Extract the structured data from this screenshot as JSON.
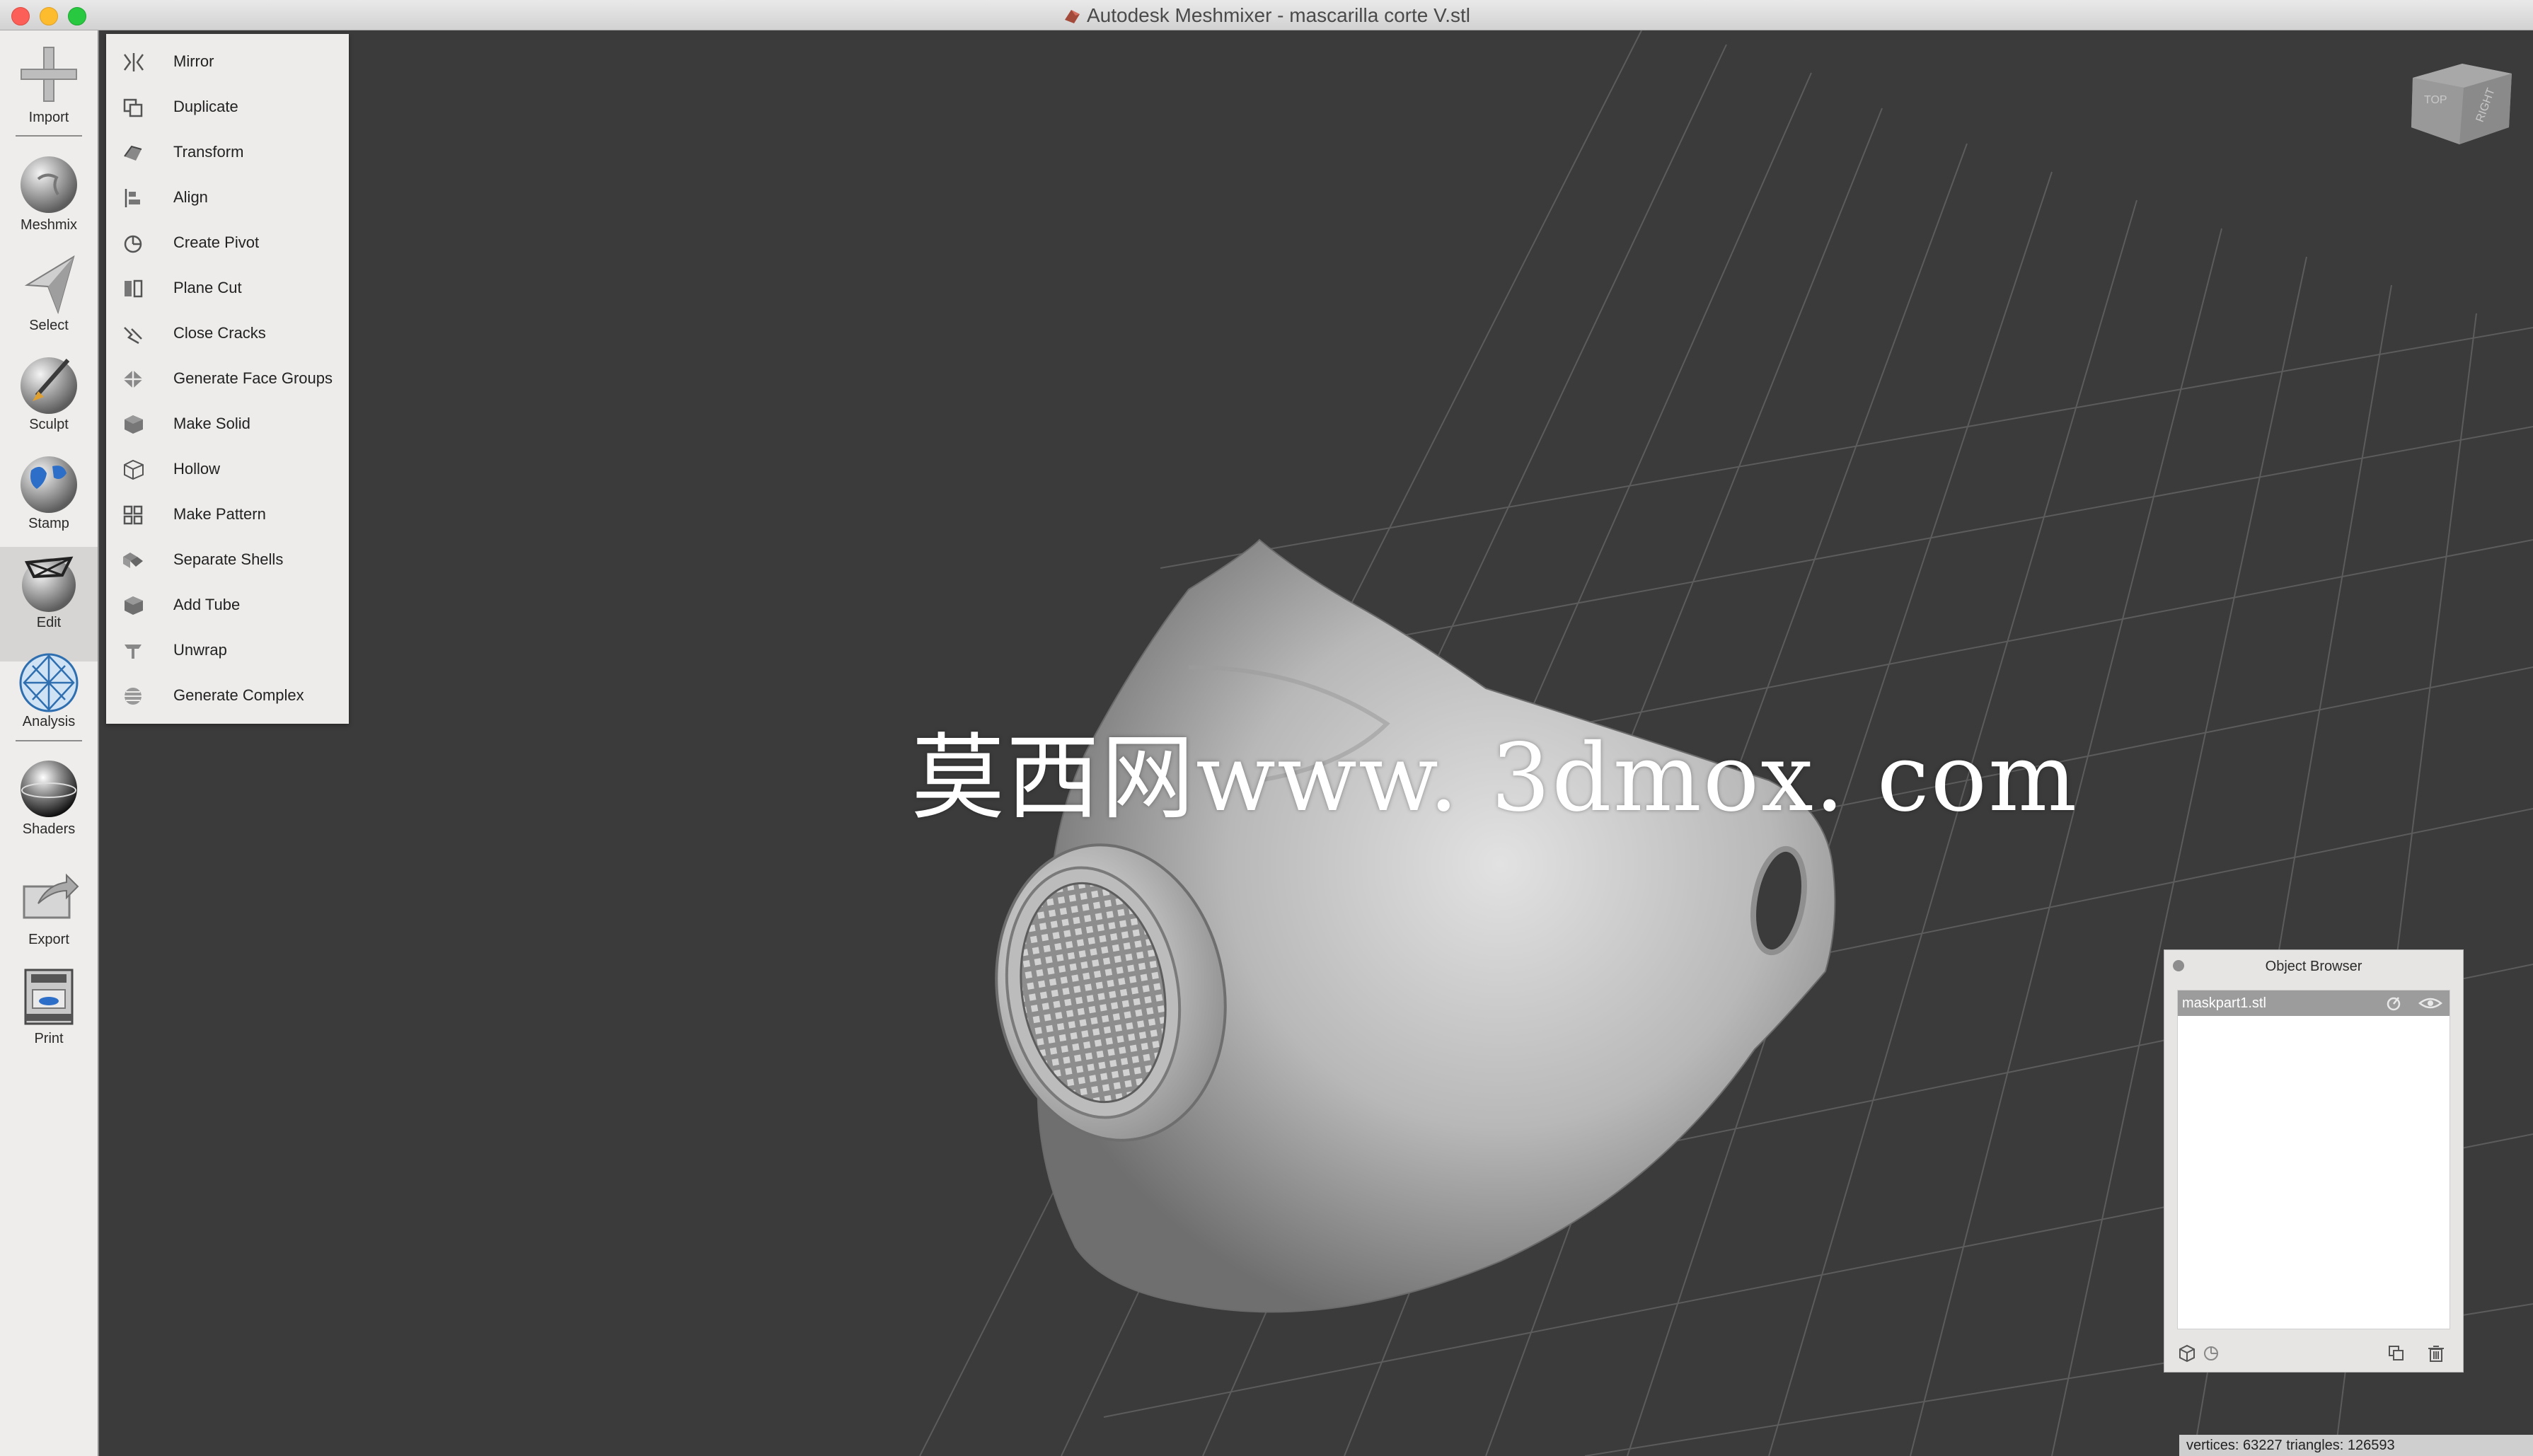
{
  "window": {
    "title": "Autodesk Meshmixer - mascarilla corte V.stl"
  },
  "toolbar": {
    "tools": [
      {
        "label": "Import",
        "icon": "import-icon"
      },
      {
        "label": "Meshmix",
        "icon": "meshmix-icon"
      },
      {
        "label": "Select",
        "icon": "select-icon"
      },
      {
        "label": "Sculpt",
        "icon": "sculpt-icon"
      },
      {
        "label": "Stamp",
        "icon": "stamp-icon"
      },
      {
        "label": "Edit",
        "icon": "edit-icon",
        "active": true
      },
      {
        "label": "Analysis",
        "icon": "analysis-icon"
      },
      {
        "label": "Shaders",
        "icon": "shaders-icon"
      },
      {
        "label": "Export",
        "icon": "export-icon"
      },
      {
        "label": "Print",
        "icon": "print-icon"
      }
    ]
  },
  "edit_menu": {
    "items": [
      {
        "label": "Mirror",
        "icon": "mirror-icon"
      },
      {
        "label": "Duplicate",
        "icon": "duplicate-icon"
      },
      {
        "label": "Transform",
        "icon": "transform-icon"
      },
      {
        "label": "Align",
        "icon": "align-icon"
      },
      {
        "label": "Create Pivot",
        "icon": "create-pivot-icon"
      },
      {
        "label": "Plane Cut",
        "icon": "plane-cut-icon"
      },
      {
        "label": "Close Cracks",
        "icon": "close-cracks-icon"
      },
      {
        "label": "Generate Face Groups",
        "icon": "face-groups-icon"
      },
      {
        "label": "Make Solid",
        "icon": "make-solid-icon"
      },
      {
        "label": "Hollow",
        "icon": "hollow-icon"
      },
      {
        "label": "Make Pattern",
        "icon": "make-pattern-icon"
      },
      {
        "label": "Separate Shells",
        "icon": "separate-shells-icon"
      },
      {
        "label": "Add Tube",
        "icon": "add-tube-icon"
      },
      {
        "label": "Unwrap",
        "icon": "unwrap-icon"
      },
      {
        "label": "Generate Complex",
        "icon": "generate-complex-icon"
      }
    ]
  },
  "viewport": {
    "watermark": "莫西网www. 3dmox. com",
    "viewcube": {
      "top": "TOP",
      "right": "RIGHT"
    }
  },
  "object_browser": {
    "title": "Object Browser",
    "objects": [
      {
        "name": "maskpart1.stl",
        "selected": true
      }
    ]
  },
  "status": {
    "text": "vertices: 63227 triangles: 126593"
  },
  "colors": {
    "viewport_bg": "#3b3b3b",
    "panel_bg": "#edeceb",
    "selected_row": "#9c9c9c"
  }
}
